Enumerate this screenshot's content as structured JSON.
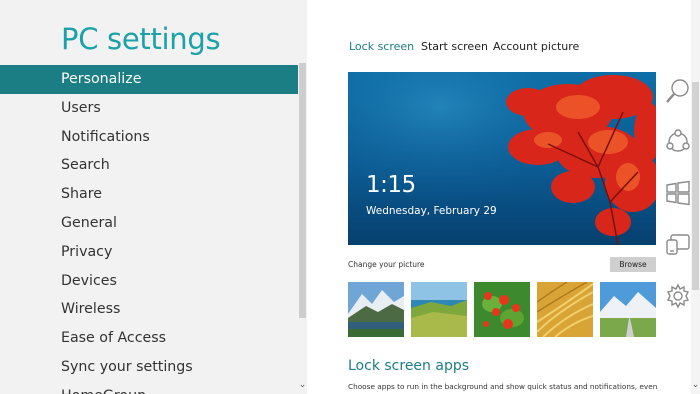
{
  "app_title": "PC settings",
  "nav": {
    "items": [
      {
        "label": "Personalize",
        "selected": true
      },
      {
        "label": "Users"
      },
      {
        "label": "Notifications"
      },
      {
        "label": "Search"
      },
      {
        "label": "Share"
      },
      {
        "label": "General"
      },
      {
        "label": "Privacy"
      },
      {
        "label": "Devices"
      },
      {
        "label": "Wireless"
      },
      {
        "label": "Ease of Access"
      },
      {
        "label": "Sync your settings"
      },
      {
        "label": "HomeGroup"
      }
    ]
  },
  "tabs": [
    {
      "label": "Lock screen",
      "active": true
    },
    {
      "label": "Start screen"
    },
    {
      "label": "Account picture"
    }
  ],
  "lock_preview": {
    "time": "1:15",
    "date": "Wednesday, February 29"
  },
  "change_picture": {
    "label": "Change your picture",
    "browse_label": "Browse"
  },
  "thumbnails": [
    {
      "name": "mountain-lake"
    },
    {
      "name": "coastal-hills"
    },
    {
      "name": "red-flowers"
    },
    {
      "name": "golden-grass"
    },
    {
      "name": "mountain-road"
    }
  ],
  "lock_screen_apps": {
    "heading": "Lock screen apps",
    "description": "Choose apps to run in the background and show quick status and notifications, even when"
  },
  "charms": [
    "search-charm-icon",
    "share-charm-icon",
    "start-charm-icon",
    "devices-charm-icon",
    "settings-charm-icon"
  ],
  "colors": {
    "accent": "#1a7e84",
    "title": "#1ba1a8",
    "left_pane_bg": "#f2f2f2"
  }
}
